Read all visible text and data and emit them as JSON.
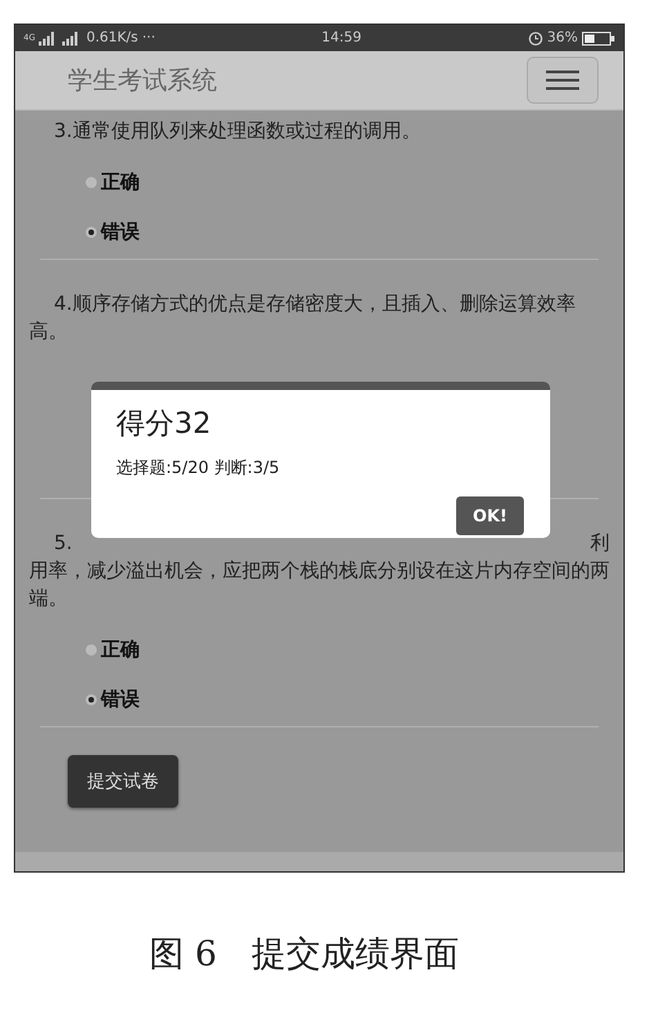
{
  "status_bar": {
    "network": "4G",
    "speed": "0.61K/s",
    "more": "···",
    "time": "14:59",
    "battery": "36%"
  },
  "navbar": {
    "title": "学生考试系统"
  },
  "questions": [
    {
      "number": "3.",
      "text": "通常使用队列来处理函数或过程的调用。",
      "options": [
        {
          "label": "正确",
          "selected": false
        },
        {
          "label": "错误",
          "selected": true
        }
      ]
    },
    {
      "number": "4.",
      "text": "顺序存储方式的优点是存储密度大，且插入、删除运算效率高。"
    },
    {
      "number": "5.",
      "tail": "利",
      "text": "用率，减少溢出机会，应把两个栈的栈底分别设在这片内存空间的两端。",
      "options": [
        {
          "label": "正确",
          "selected": false
        },
        {
          "label": "错误",
          "selected": true
        }
      ]
    }
  ],
  "submit_button": "提交试卷",
  "dialog": {
    "title": "得分32",
    "message": "选择题:5/20 判断:3/5",
    "button": "OK!"
  },
  "caption": "图 6　提交成绩界面"
}
